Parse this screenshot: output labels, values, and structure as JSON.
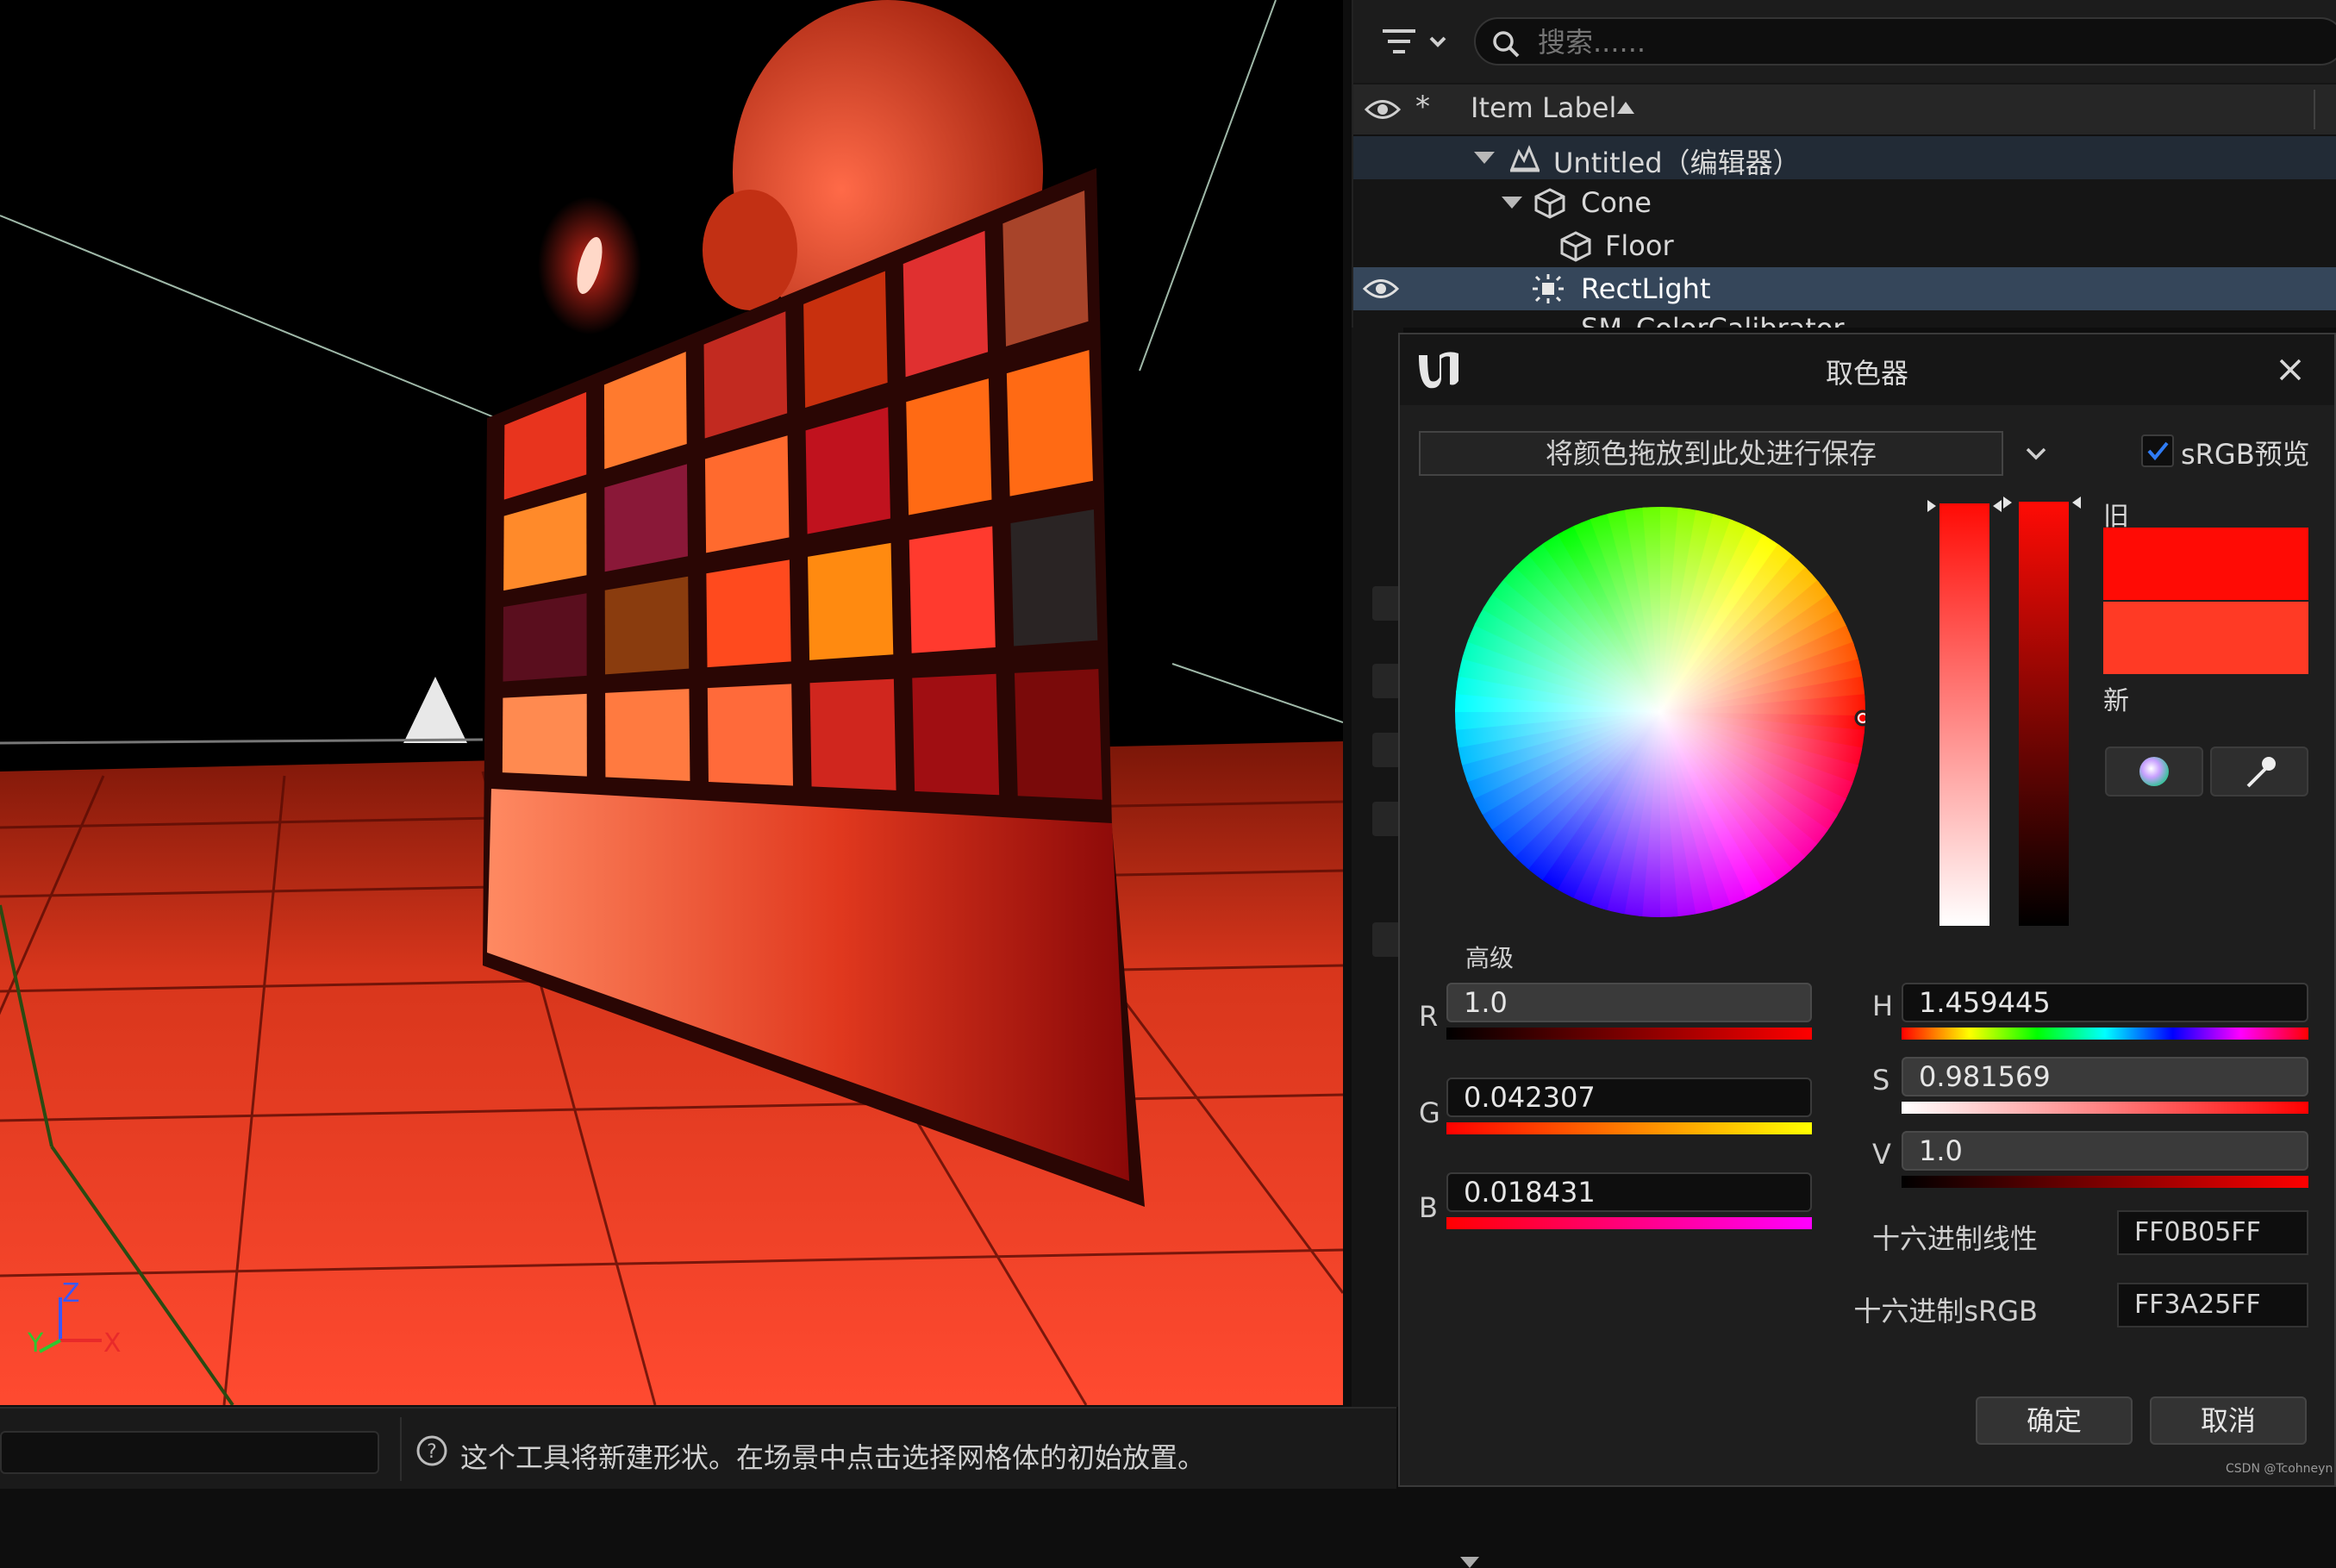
{
  "outliner": {
    "search_placeholder": "搜索......",
    "column_header": "Item Label",
    "items": [
      {
        "label": "Untitled（编辑器）"
      },
      {
        "label": "Cone"
      },
      {
        "label": "Floor"
      },
      {
        "label": "RectLight"
      },
      {
        "label": "SM_ColorCalibrator"
      }
    ]
  },
  "viewport": {
    "axis_labels": {
      "z": "Z",
      "x": "X",
      "y": "Y"
    }
  },
  "status_bar": {
    "message": "这个工具将新建形状。在场景中点击选择网格体的初始放置。"
  },
  "color_picker": {
    "title": "取色器",
    "drop_zone_text": "将颜色拖放到此处进行保存",
    "srgb_preview_label": "sRGB预览",
    "srgb_preview_checked": true,
    "old_label": "旧",
    "new_label": "新",
    "old_color": "#FF0B05",
    "new_color": "#FF3A25",
    "advanced_label": "高级",
    "channels": {
      "r": {
        "label": "R",
        "value": "1.0"
      },
      "g": {
        "label": "G",
        "value": "0.042307"
      },
      "b": {
        "label": "B",
        "value": "0.018431"
      },
      "h": {
        "label": "H",
        "value": "1.459445"
      },
      "s": {
        "label": "S",
        "value": "0.981569"
      },
      "v": {
        "label": "V",
        "value": "1.0"
      }
    },
    "hex_linear": {
      "label": "十六进制线性",
      "value": "FF0B05FF"
    },
    "hex_srgb": {
      "label": "十六进制sRGB",
      "value": "FF3A25FF"
    },
    "ok_label": "确定",
    "cancel_label": "取消"
  },
  "watermark": "CSDN @Tcohneyn",
  "icons": {
    "filter": "filter-icon",
    "search": "search-icon",
    "visibility": "eye-icon",
    "pin": "star-icon",
    "level": "level-icon",
    "mesh": "static-mesh-icon",
    "light": "rect-light-icon",
    "close": "close-icon",
    "ue_logo": "unreal-logo-icon",
    "color_wheel": "color-wheel-icon",
    "eyedropper": "eyedropper-icon",
    "help": "help-icon"
  }
}
